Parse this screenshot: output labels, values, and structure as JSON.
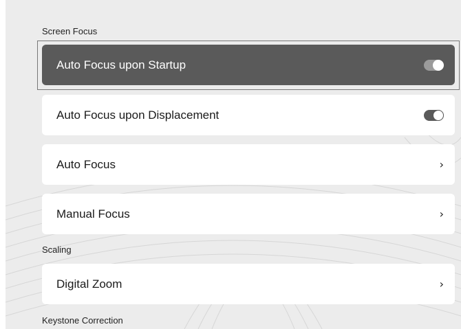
{
  "sections": {
    "screen_focus": "Screen Focus",
    "scaling": "Scaling",
    "keystone": "Keystone Correction"
  },
  "items": {
    "auto_focus_startup": {
      "label": "Auto Focus upon Startup",
      "toggle": "on"
    },
    "auto_focus_displacement": {
      "label": "Auto Focus upon Displacement",
      "toggle": "off"
    },
    "auto_focus": {
      "label": "Auto Focus",
      "icon": "chevron-right-icon",
      "glyph": "›"
    },
    "manual_focus": {
      "label": "Manual Focus",
      "icon": "chevron-right-icon",
      "glyph": "›"
    },
    "digital_zoom": {
      "label": "Digital Zoom",
      "icon": "chevron-right-icon",
      "glyph": "›"
    }
  },
  "colors": {
    "background": "#ececec",
    "card": "#ffffff",
    "focused_card": "#5a5a5a",
    "text": "#1a1a1a"
  }
}
